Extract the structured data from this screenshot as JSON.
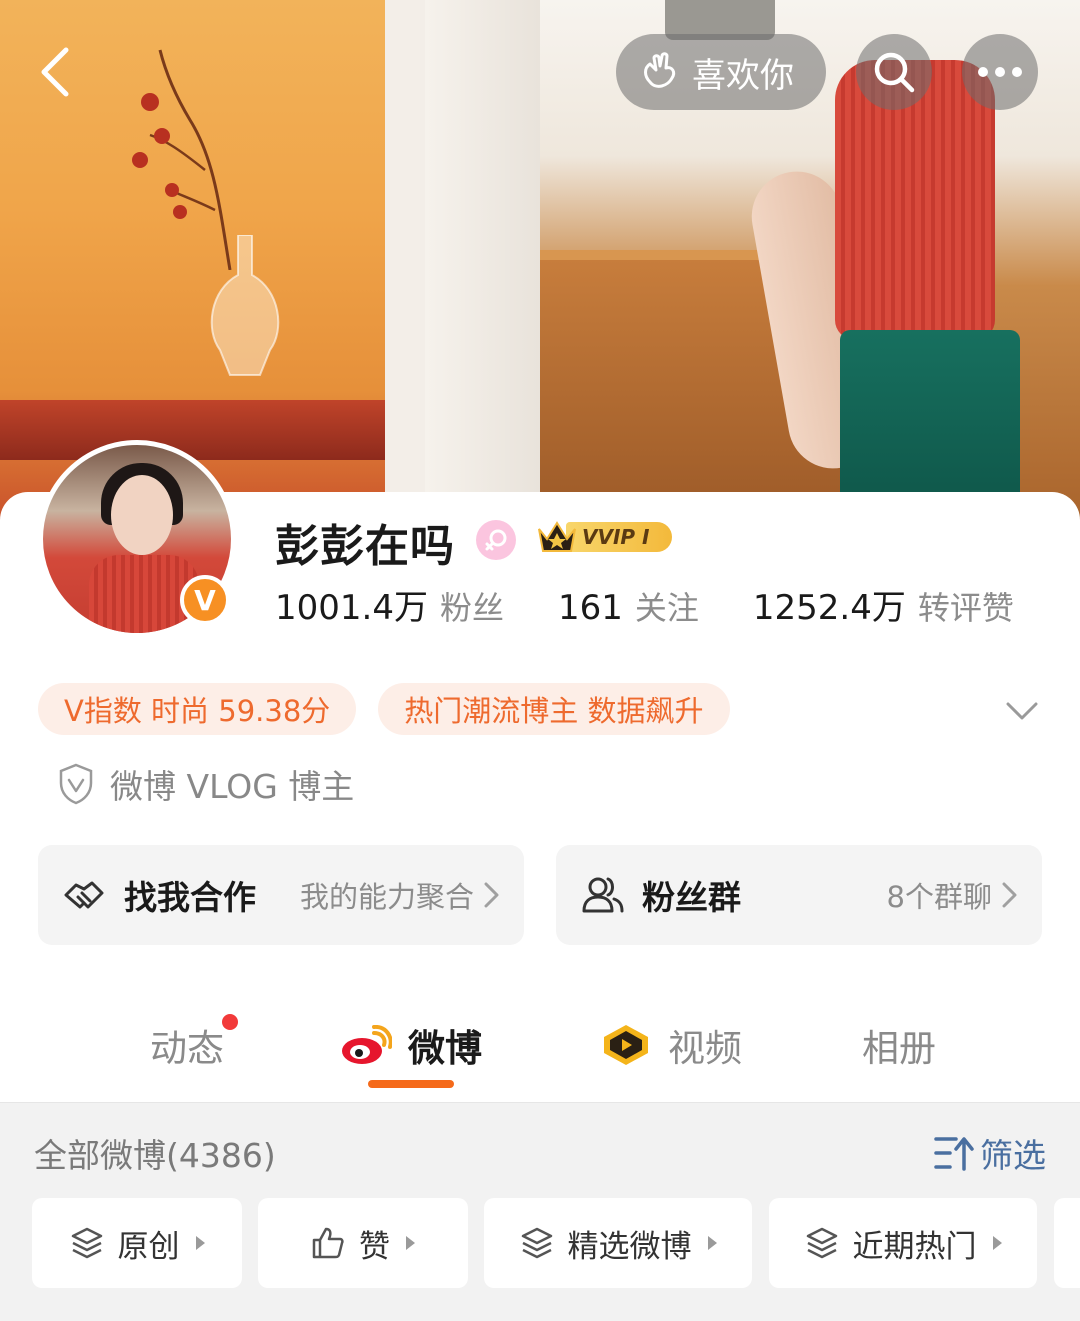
{
  "header": {
    "like_label": "喜欢你",
    "back_icon": "chevron-left-icon",
    "search_icon": "search-icon",
    "more_icon": "more-dots-icon"
  },
  "profile": {
    "name": "彭彭在吗",
    "gender_icon": "female-icon",
    "vip_badge": "VVIP I",
    "verified_badge": "V",
    "stats": [
      {
        "value": "1001.4万",
        "label": "粉丝"
      },
      {
        "value": "161",
        "label": "关注"
      },
      {
        "value": "1252.4万",
        "label": "转评赞"
      }
    ],
    "tags": [
      "V指数 时尚 59.38分",
      "热门潮流博主 数据飙升"
    ],
    "certification": "微博 VLOG 博主"
  },
  "actions": {
    "coop": {
      "label": "找我合作",
      "sub": "我的能力聚合"
    },
    "fans": {
      "label": "粉丝群",
      "sub": "8个群聊"
    }
  },
  "tabs": [
    {
      "label": "动态",
      "has_dot": true
    },
    {
      "label": "微博",
      "active": true
    },
    {
      "label": "视频"
    },
    {
      "label": "相册"
    }
  ],
  "feed": {
    "title": "全部微博(4386)",
    "filter_label": "筛选",
    "chips": [
      "原创",
      "赞",
      "精选微博",
      "近期热门"
    ]
  },
  "colors": {
    "accent": "#f56a1a",
    "tag_text": "#ee6a2e",
    "tag_bg": "#fdeee7",
    "filter_blue": "#4a6fa0",
    "verified_orange": "#f79023"
  }
}
